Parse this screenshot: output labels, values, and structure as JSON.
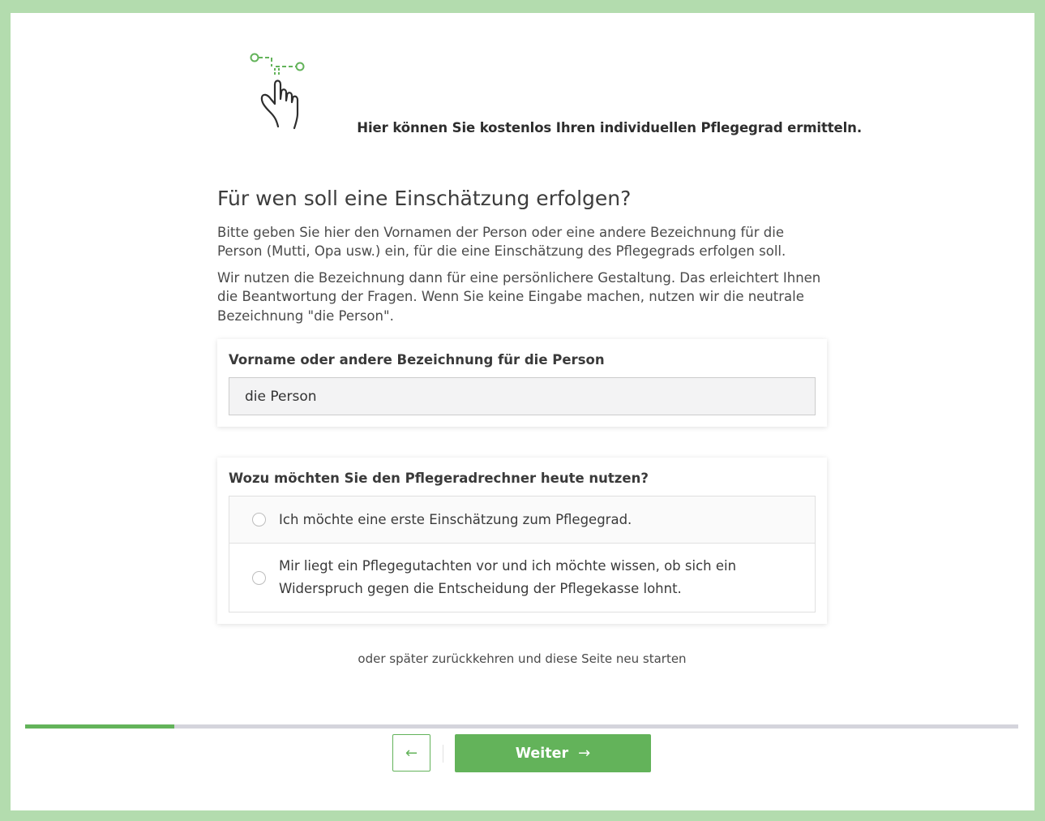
{
  "header": {
    "icon": "hand-pointer-icon",
    "tagline": "Hier können Sie kostenlos Ihren individuellen Pflegegrad ermitteln."
  },
  "main": {
    "title": "Für wen soll eine Einschätzung erfolgen?",
    "intro": [
      "Bitte geben Sie hier den Vornamen der Person oder eine andere Bezeichnung für die Person (Mutti, Opa usw.) ein, für die eine Einschätzung des Pflegegrads erfolgen soll.",
      "Wir nutzen die Bezeichnung dann für eine persönlichere Gestaltung. Das erleichtert Ihnen die Beantwortung der Fragen. Wenn Sie keine Eingabe machen, nutzen wir die neutrale Bezeichnung \"die Person\"."
    ],
    "name_field": {
      "label": "Vorname oder andere Bezeichnung für die Person",
      "value": "die Person"
    },
    "usage_question": {
      "label": "Wozu möchten Sie den Pflegeradrechner heute nutzen?",
      "options": [
        {
          "label": "Ich möchte eine erste Einschätzung zum Pflegegrad.",
          "selected": false
        },
        {
          "label": "Mir liegt ein Pflegegutachten vor und ich möchte wissen, ob sich ein Widerspruch gegen die Entscheidung der Pflegekasse lohnt.",
          "selected": false
        }
      ]
    },
    "later_link": "oder später zurückkehren und diese Seite neu starten"
  },
  "progress": {
    "fraction": 0.15
  },
  "navigation": {
    "back_icon": "arrow-left-icon",
    "back_symbol": "←",
    "next_label": "Weiter",
    "next_icon": "arrow-right-icon",
    "next_symbol": "→"
  },
  "colors": {
    "accent": "#63b35a",
    "page_background": "#b3dcae",
    "progress_track": "#d4d4dc"
  }
}
